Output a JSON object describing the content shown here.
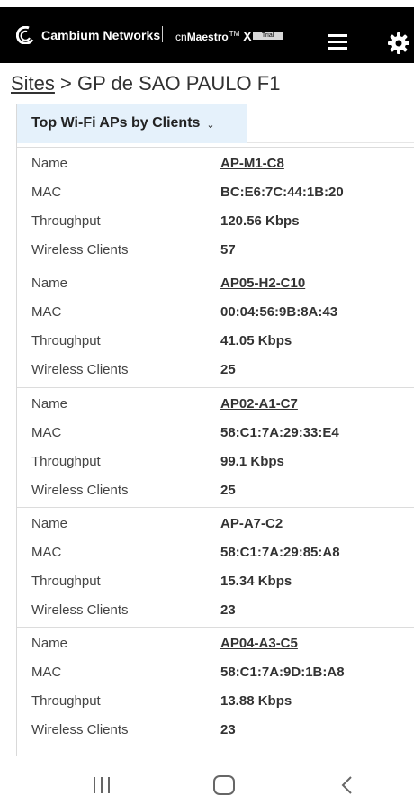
{
  "header": {
    "brand": "Cambium Networks",
    "product_prefix": "cn",
    "product_name": "Maestro",
    "product_tm": "TM",
    "product_x": "X",
    "trial_badge": "Trial"
  },
  "breadcrumb": {
    "sites_link": "Sites",
    "separator": ">",
    "current": "GP de SAO PAULO F1"
  },
  "panel": {
    "title": "Top Wi-Fi APs by Clients",
    "labels": {
      "name": "Name",
      "mac": "MAC",
      "throughput": "Throughput",
      "clients": "Wireless Clients"
    },
    "aps": [
      {
        "name": "AP-M1-C8",
        "mac": "BC:E6:7C:44:1B:20",
        "throughput": "120.56 Kbps",
        "clients": "57"
      },
      {
        "name": "AP05-H2-C10",
        "mac": "00:04:56:9B:8A:43",
        "throughput": "41.05 Kbps",
        "clients": "25"
      },
      {
        "name": "AP02-A1-C7",
        "mac": "58:C1:7A:29:33:E4",
        "throughput": "99.1 Kbps",
        "clients": "25"
      },
      {
        "name": "AP-A7-C2",
        "mac": "58:C1:7A:29:85:A8",
        "throughput": "15.34 Kbps",
        "clients": "23"
      },
      {
        "name": "AP04-A3-C5",
        "mac": "58:C1:7A:9D:1B:A8",
        "throughput": "13.88 Kbps",
        "clients": "23"
      }
    ]
  },
  "icons": {
    "logo": "cambium-logo-icon",
    "menu": "hamburger-menu-icon",
    "settings": "gear-icon",
    "nav_recents": "recent-apps-icon",
    "nav_home": "home-icon",
    "nav_back": "back-icon"
  },
  "colors": {
    "topbar_bg": "#000000",
    "panel_header_bg": "#e5f1fb"
  }
}
